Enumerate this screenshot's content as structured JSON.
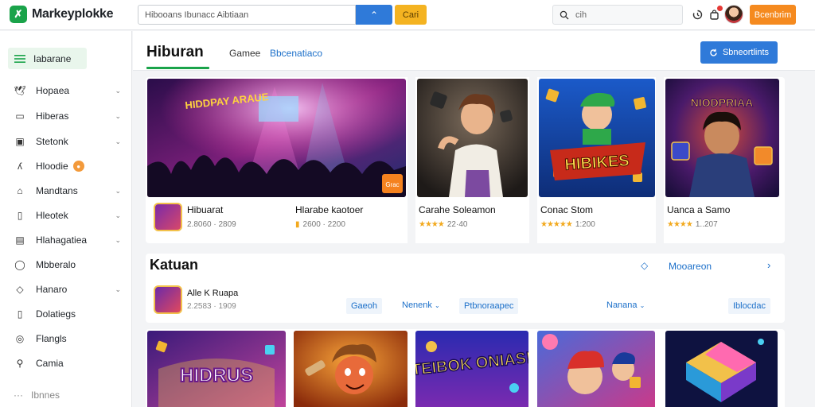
{
  "brand": {
    "name": "Markeyplokke",
    "logo_glyph": "✗"
  },
  "search": {
    "value": "Hibooans Ibunacc Aibtiaan",
    "button_glyph": "⌃",
    "cari_label": "Cari"
  },
  "search2": {
    "placeholder": "cih"
  },
  "header": {
    "cta_label": "Bcenbrim"
  },
  "sidebar": {
    "head_label": "Iabarane",
    "items": [
      {
        "label": "Hopaea",
        "icon": "bird-icon",
        "chevron": true
      },
      {
        "label": "Hiberas",
        "icon": "monitor-icon",
        "chevron": true
      },
      {
        "label": "Stetonk",
        "icon": "id-card-icon",
        "chevron": true
      },
      {
        "label": "Hloodie",
        "icon": "script-icon",
        "badge": "●"
      },
      {
        "label": "Mandtans",
        "icon": "home-icon",
        "chevron": true
      },
      {
        "label": "Hleotek",
        "icon": "phone-icon",
        "chevron": true
      },
      {
        "label": "Hlahagatiea",
        "icon": "clipboard-icon",
        "chevron": true
      },
      {
        "label": "Mbberalo",
        "icon": "chat-icon"
      },
      {
        "label": "Hanaro",
        "icon": "tag-icon",
        "chevron": true
      },
      {
        "label": "Dolatiegs",
        "icon": "file-icon"
      },
      {
        "label": "Flangls",
        "icon": "ring-icon"
      },
      {
        "label": "Camia",
        "icon": "search-icon"
      }
    ],
    "more_label": "Ibnnes",
    "more_glyph": "···"
  },
  "main": {
    "title": "Hiburan",
    "tabs": [
      {
        "label": "Gamee",
        "active": false
      },
      {
        "label": "Bbcenatiaco",
        "active": true
      }
    ],
    "cta_label": "Sbneortlints"
  },
  "cards": [
    {
      "title": "Hibuarat",
      "meta": "2.8060 · 2809",
      "thumb_text": "HIDDPAY ARAUE",
      "price": "Grac"
    },
    {
      "title": "Hlarabe kaotoer",
      "meta": "2600 · 2200"
    },
    {
      "title": "Carahe Soleamon",
      "meta": "22·40",
      "rating": "★★★★"
    },
    {
      "title": "Conac Stom",
      "meta": "1:200",
      "rating": "★★★★★",
      "thumb_text": "HIBIKES"
    },
    {
      "title": "Uanca a Samo",
      "meta": "1..207",
      "rating": "★★★★",
      "thumb_text": "NIODPRIAA"
    }
  ],
  "section2": {
    "title": "Katuan",
    "link": "Mooareon",
    "app_name": "Alle K Ruapa",
    "app_sub": "2.2583 · 1909",
    "chips": [
      "Gaeoh",
      "Nenenk",
      "Ptbnoraapec",
      "Nanana",
      "Iblocdac"
    ]
  },
  "row3": [
    {
      "thumb_text": "HIDRUS"
    },
    {
      "thumb_text": ""
    },
    {
      "thumb_text": "TEIBOK ONIAS!"
    },
    {
      "thumb_text": ""
    },
    {
      "thumb_text": ""
    }
  ],
  "colors": {
    "accent_green": "#1aa34a",
    "accent_blue": "#2f7ad9",
    "orange": "#f58a1f",
    "yellow": "#f4b321"
  }
}
